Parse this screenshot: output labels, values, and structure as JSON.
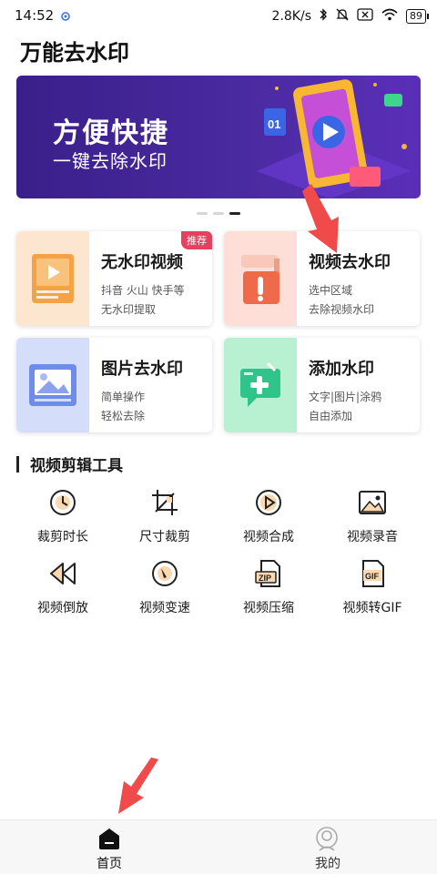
{
  "status_bar": {
    "time": "14:52",
    "speed": "2.8K/s",
    "battery": "89"
  },
  "app": {
    "title": "万能去水印"
  },
  "banner": {
    "title": "方便快捷",
    "subtitle": "一键去除水印",
    "art_number": "01"
  },
  "features": [
    {
      "title": "无水印视频",
      "line1": "抖音 火山 快手等",
      "line2": "无水印提取",
      "badge": "推荐",
      "icon": "video-player-icon",
      "bg": "#fde6cf"
    },
    {
      "title": "视频去水印",
      "line1": "选中区域",
      "line2": "去除视频水印",
      "icon": "paint-roller-icon",
      "bg": "#fddfd8"
    },
    {
      "title": "图片去水印",
      "line1": "简单操作",
      "line2": "轻松去除",
      "icon": "picture-icon",
      "bg": "#d4ddfa"
    },
    {
      "title": "添加水印",
      "line1": "文字|图片|涂鸦",
      "line2": "自由添加",
      "icon": "add-watermark-icon",
      "bg": "#b8f0d2"
    }
  ],
  "tools_section": {
    "title": "视频剪辑工具"
  },
  "tools": [
    {
      "label": "裁剪时长",
      "icon": "clock-icon"
    },
    {
      "label": "尺寸裁剪",
      "icon": "crop-icon"
    },
    {
      "label": "视频合成",
      "icon": "play-circle-icon"
    },
    {
      "label": "视频录音",
      "icon": "image-icon"
    },
    {
      "label": "视频倒放",
      "icon": "rewind-icon"
    },
    {
      "label": "视频变速",
      "icon": "speed-dial-icon"
    },
    {
      "label": "视频压缩",
      "icon": "zip-icon"
    },
    {
      "label": "视频转GIF",
      "icon": "gif-icon"
    }
  ],
  "tool_icon_labels": {
    "zip": "ZIP",
    "gif": "GIF"
  },
  "nav": {
    "home": "首页",
    "mine": "我的"
  },
  "colors": {
    "accent": "#f39a3c",
    "badge": "#e6405e",
    "annotation_arrow": "#f04a4a",
    "banner": "#3a1f8a"
  }
}
